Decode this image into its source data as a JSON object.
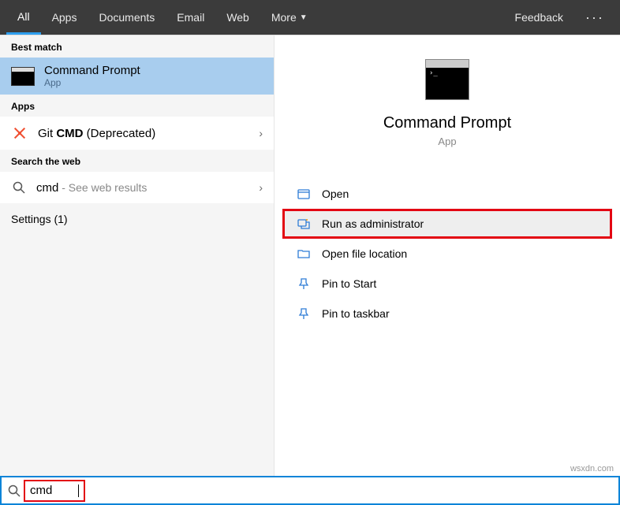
{
  "header": {
    "tabs": [
      "All",
      "Apps",
      "Documents",
      "Email",
      "Web",
      "More"
    ],
    "active_tab": "All",
    "feedback": "Feedback"
  },
  "left": {
    "best_match_header": "Best match",
    "best_match": {
      "title": "Command Prompt",
      "sub": "App"
    },
    "apps_header": "Apps",
    "git_prefix": "Git ",
    "git_bold": "CMD",
    "git_suffix": " (Deprecated)",
    "search_web_header": "Search the web",
    "web_query": "cmd",
    "web_hint": " - See web results",
    "settings": "Settings (1)"
  },
  "preview": {
    "title": "Command Prompt",
    "sub": "App",
    "actions": {
      "open": "Open",
      "run_admin": "Run as administrator",
      "file_loc": "Open file location",
      "pin_start": "Pin to Start",
      "pin_taskbar": "Pin to taskbar"
    }
  },
  "search": {
    "value": "cmd"
  },
  "watermark": "wsxdn.com"
}
